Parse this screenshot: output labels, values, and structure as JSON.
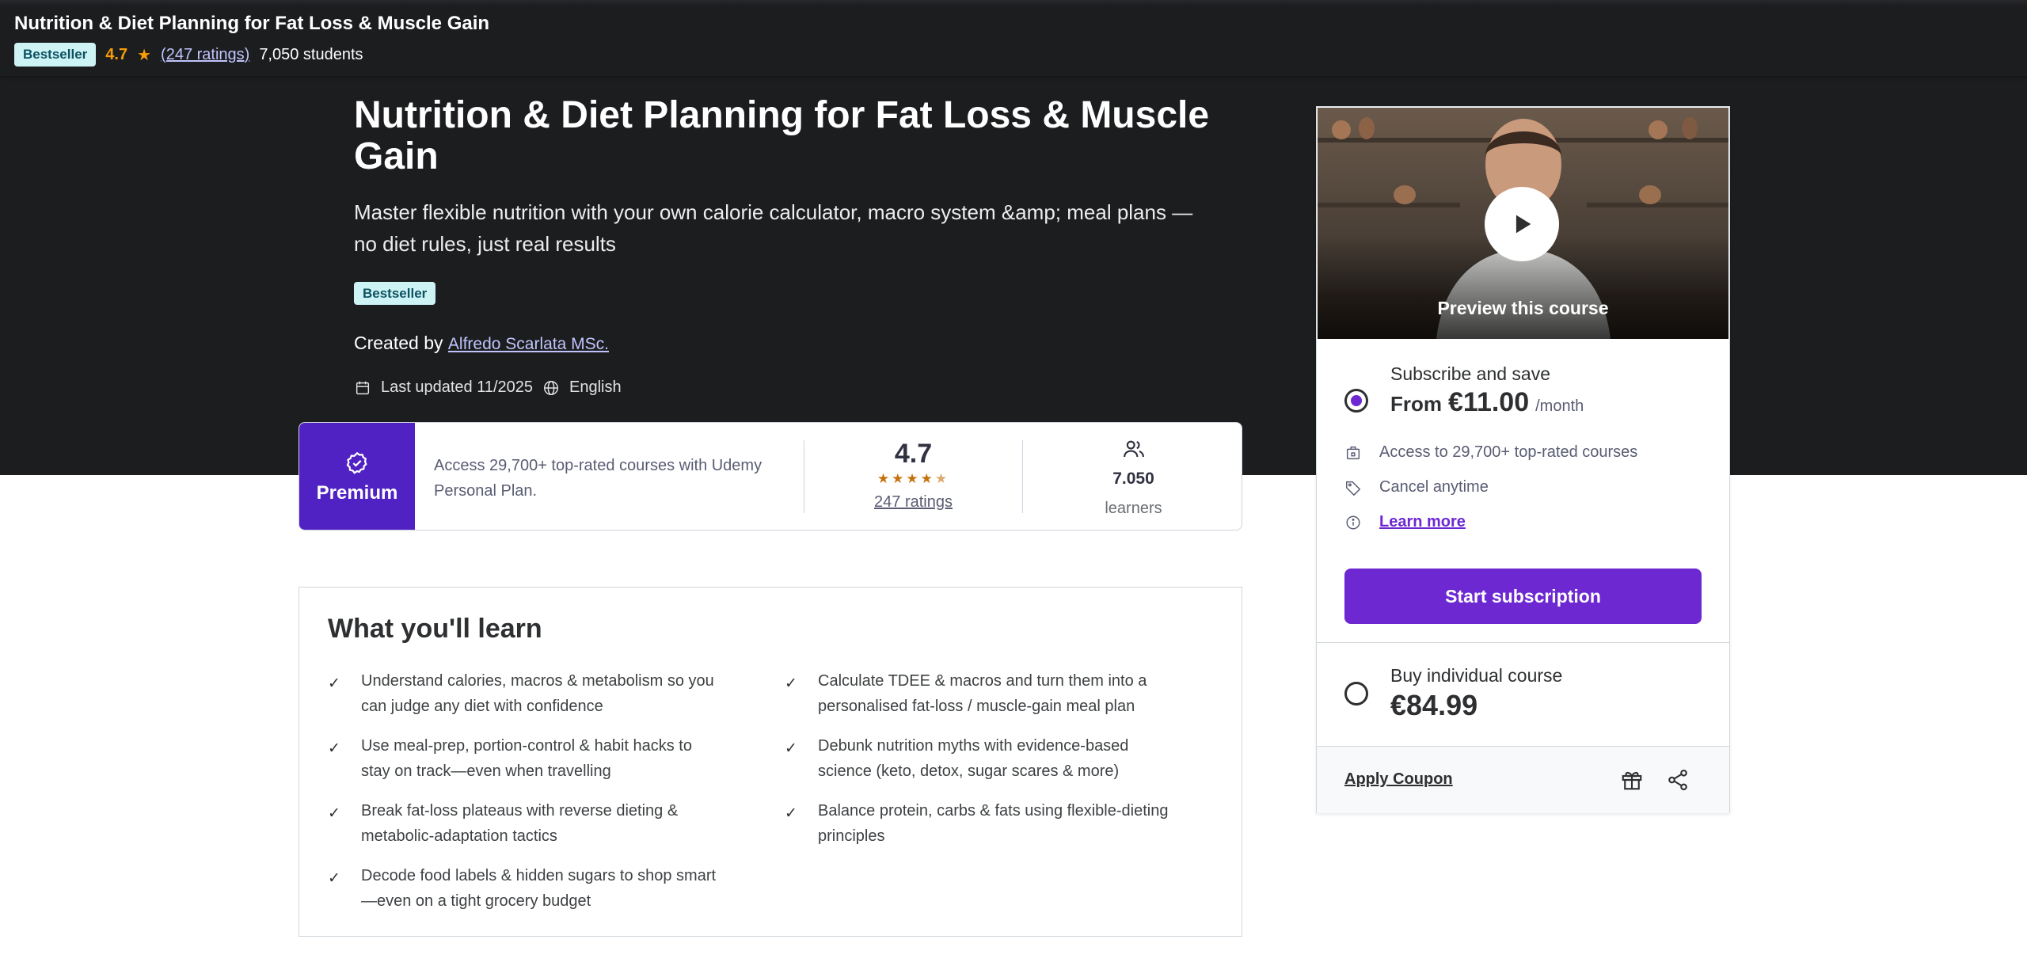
{
  "sticky": {
    "title": "Nutrition & Diet Planning for Fat Loss & Muscle Gain",
    "badge": "Bestseller",
    "rating": "4.7",
    "ratings_link": "(247 ratings)",
    "students": "7,050 students"
  },
  "hero": {
    "title": "Nutrition & Diet Planning for Fat Loss & Muscle Gain",
    "subtitle": "Master flexible nutrition with your own calorie calculator, macro system &amp; meal plans — no diet rules, just real results",
    "badge": "Bestseller",
    "created_by_label": "Created by",
    "instructor": "Alfredo Scarlata MSc.",
    "last_updated": "Last updated 11/2025",
    "language": "English"
  },
  "stats": {
    "premium_label": "Premium",
    "premium_text": "Access 29,700+ top-rated courses with Udemy Personal Plan.",
    "rating": "4.7",
    "rating_stars_value": 4.7,
    "ratings_link": "247 ratings",
    "learners_count": "7.050",
    "learners_label": "learners"
  },
  "learn": {
    "title": "What you'll learn",
    "items": [
      "Understand calories, macros & metabolism so you can judge any diet with confidence",
      "Calculate TDEE & macros and turn them into a personalised fat-loss / muscle-gain meal plan",
      "Use meal-prep, portion-control & habit hacks to stay on track—even when travelling",
      "Debunk nutrition myths with evidence-based science (keto, detox, sugar scares & more)",
      "Break fat-loss plateaus with reverse dieting & metabolic-adaptation tactics",
      "Balance protein, carbs & fats using flexible-dieting principles",
      "Decode food labels & hidden sugars to shop smart—even on a tight grocery budget"
    ]
  },
  "sidebar": {
    "preview_label": "Preview this course",
    "subscribe": {
      "title": "Subscribe and save",
      "from_label": "From",
      "price": "€11.00",
      "period": "/month",
      "selected": true
    },
    "features": [
      {
        "icon": "building-icon",
        "text": "Access to 29,700+ top-rated courses"
      },
      {
        "icon": "tag-icon",
        "text": "Cancel anytime"
      },
      {
        "icon": "info-icon",
        "text": "Learn more"
      }
    ],
    "cta": "Start subscription",
    "buy": {
      "title": "Buy individual course",
      "price": "€84.99",
      "selected": false
    },
    "apply_coupon": "Apply Coupon"
  },
  "colors": {
    "hero_bg": "#1c1d1f",
    "accent_purple": "#6d28d2",
    "premium_purple": "#5022c3",
    "badge_bg": "#cef3f5",
    "star_orange": "#f69c08"
  }
}
